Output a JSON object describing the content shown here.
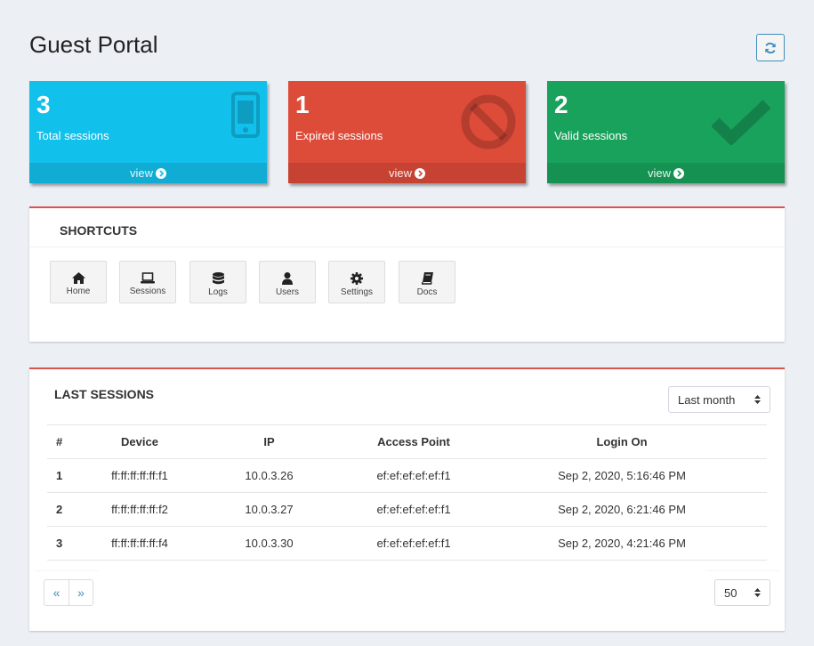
{
  "page": {
    "title": "Guest Portal"
  },
  "header": {
    "refresh_icon": "refresh-icon"
  },
  "stats": [
    {
      "value": "3",
      "label": "Total sessions",
      "link": "view",
      "color": "#12c0ec",
      "icon": "mobile-phone-icon"
    },
    {
      "value": "1",
      "label": "Expired sessions",
      "link": "view",
      "color": "#dd4b39",
      "icon": "ban-icon"
    },
    {
      "value": "2",
      "label": "Valid sessions",
      "link": "view",
      "color": "#18a25c",
      "icon": "check-icon"
    }
  ],
  "shortcuts": {
    "title": "SHORTCUTS",
    "items": [
      {
        "label": "Home",
        "icon": "home-icon"
      },
      {
        "label": "Sessions",
        "icon": "laptop-icon"
      },
      {
        "label": "Logs",
        "icon": "database-icon"
      },
      {
        "label": "Users",
        "icon": "user-icon"
      },
      {
        "label": "Settings",
        "icon": "gear-icon"
      },
      {
        "label": "Docs",
        "icon": "book-icon"
      }
    ]
  },
  "sessions": {
    "title": "LAST SESSIONS",
    "range_select": "Last month",
    "columns": [
      "#",
      "Device",
      "IP",
      "Access Point",
      "Login On"
    ],
    "rows": [
      [
        "1",
        "ff:ff:ff:ff:ff:f1",
        "10.0.3.26",
        "ef:ef:ef:ef:ef:f1",
        "Sep 2, 2020, 5:16:46 PM"
      ],
      [
        "2",
        "ff:ff:ff:ff:ff:f2",
        "10.0.3.27",
        "ef:ef:ef:ef:ef:f1",
        "Sep 2, 2020, 6:21:46 PM"
      ],
      [
        "3",
        "ff:ff:ff:ff:ff:f4",
        "10.0.3.30",
        "ef:ef:ef:ef:ef:f1",
        "Sep 2, 2020, 4:21:46 PM"
      ]
    ],
    "pager": {
      "prev": "«",
      "next": "»"
    },
    "page_size": "50"
  }
}
